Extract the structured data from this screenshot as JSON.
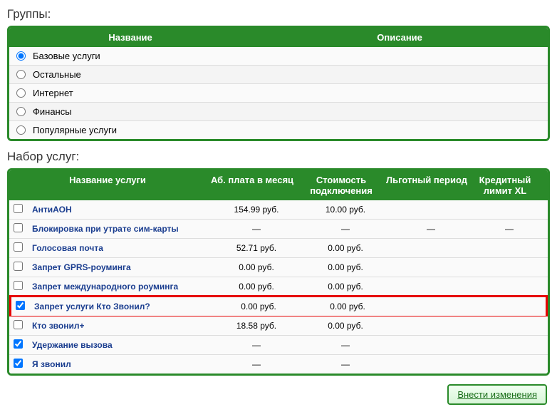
{
  "groups": {
    "title": "Группы:",
    "headers": {
      "name": "Название",
      "desc": "Описание"
    },
    "items": [
      {
        "label": "Базовые услуги",
        "selected": true
      },
      {
        "label": "Остальные",
        "selected": false
      },
      {
        "label": "Интернет",
        "selected": false
      },
      {
        "label": "Финансы",
        "selected": false
      },
      {
        "label": "Популярные услуги",
        "selected": false
      }
    ]
  },
  "services": {
    "title": "Набор услуг:",
    "headers": {
      "name": "Название услуги",
      "fee": "Аб. плата в месяц",
      "cost": "Стоимость подключения",
      "grace": "Льготный период",
      "limit": "Кредитный лимит XL"
    },
    "items": [
      {
        "checked": false,
        "name": "АнтиАОН",
        "fee": "154.99 руб.",
        "cost": "10.00 руб.",
        "grace": "",
        "limit": "",
        "highlight": false
      },
      {
        "checked": false,
        "name": "Блокировка при утрате сим-карты",
        "fee": "—",
        "cost": "—",
        "grace": "—",
        "limit": "—",
        "highlight": false
      },
      {
        "checked": false,
        "name": "Голосовая почта",
        "fee": "52.71 руб.",
        "cost": "0.00 руб.",
        "grace": "",
        "limit": "",
        "highlight": false
      },
      {
        "checked": false,
        "name": "Запрет GPRS-роуминга",
        "fee": "0.00 руб.",
        "cost": "0.00 руб.",
        "grace": "",
        "limit": "",
        "highlight": false
      },
      {
        "checked": false,
        "name": "Запрет международного роуминга",
        "fee": "0.00 руб.",
        "cost": "0.00 руб.",
        "grace": "",
        "limit": "",
        "highlight": false
      },
      {
        "checked": true,
        "name": "Запрет услуги Кто Звонил?",
        "fee": "0.00 руб.",
        "cost": "0.00 руб.",
        "grace": "",
        "limit": "",
        "highlight": true
      },
      {
        "checked": false,
        "name": "Кто звонил+",
        "fee": "18.58 руб.",
        "cost": "0.00 руб.",
        "grace": "",
        "limit": "",
        "highlight": false
      },
      {
        "checked": true,
        "name": "Удержание вызова",
        "fee": "—",
        "cost": "—",
        "grace": "",
        "limit": "",
        "highlight": false
      },
      {
        "checked": true,
        "name": "Я звонил",
        "fee": "—",
        "cost": "—",
        "grace": "",
        "limit": "",
        "highlight": false
      }
    ]
  },
  "button": {
    "label": "Внести изменения"
  }
}
